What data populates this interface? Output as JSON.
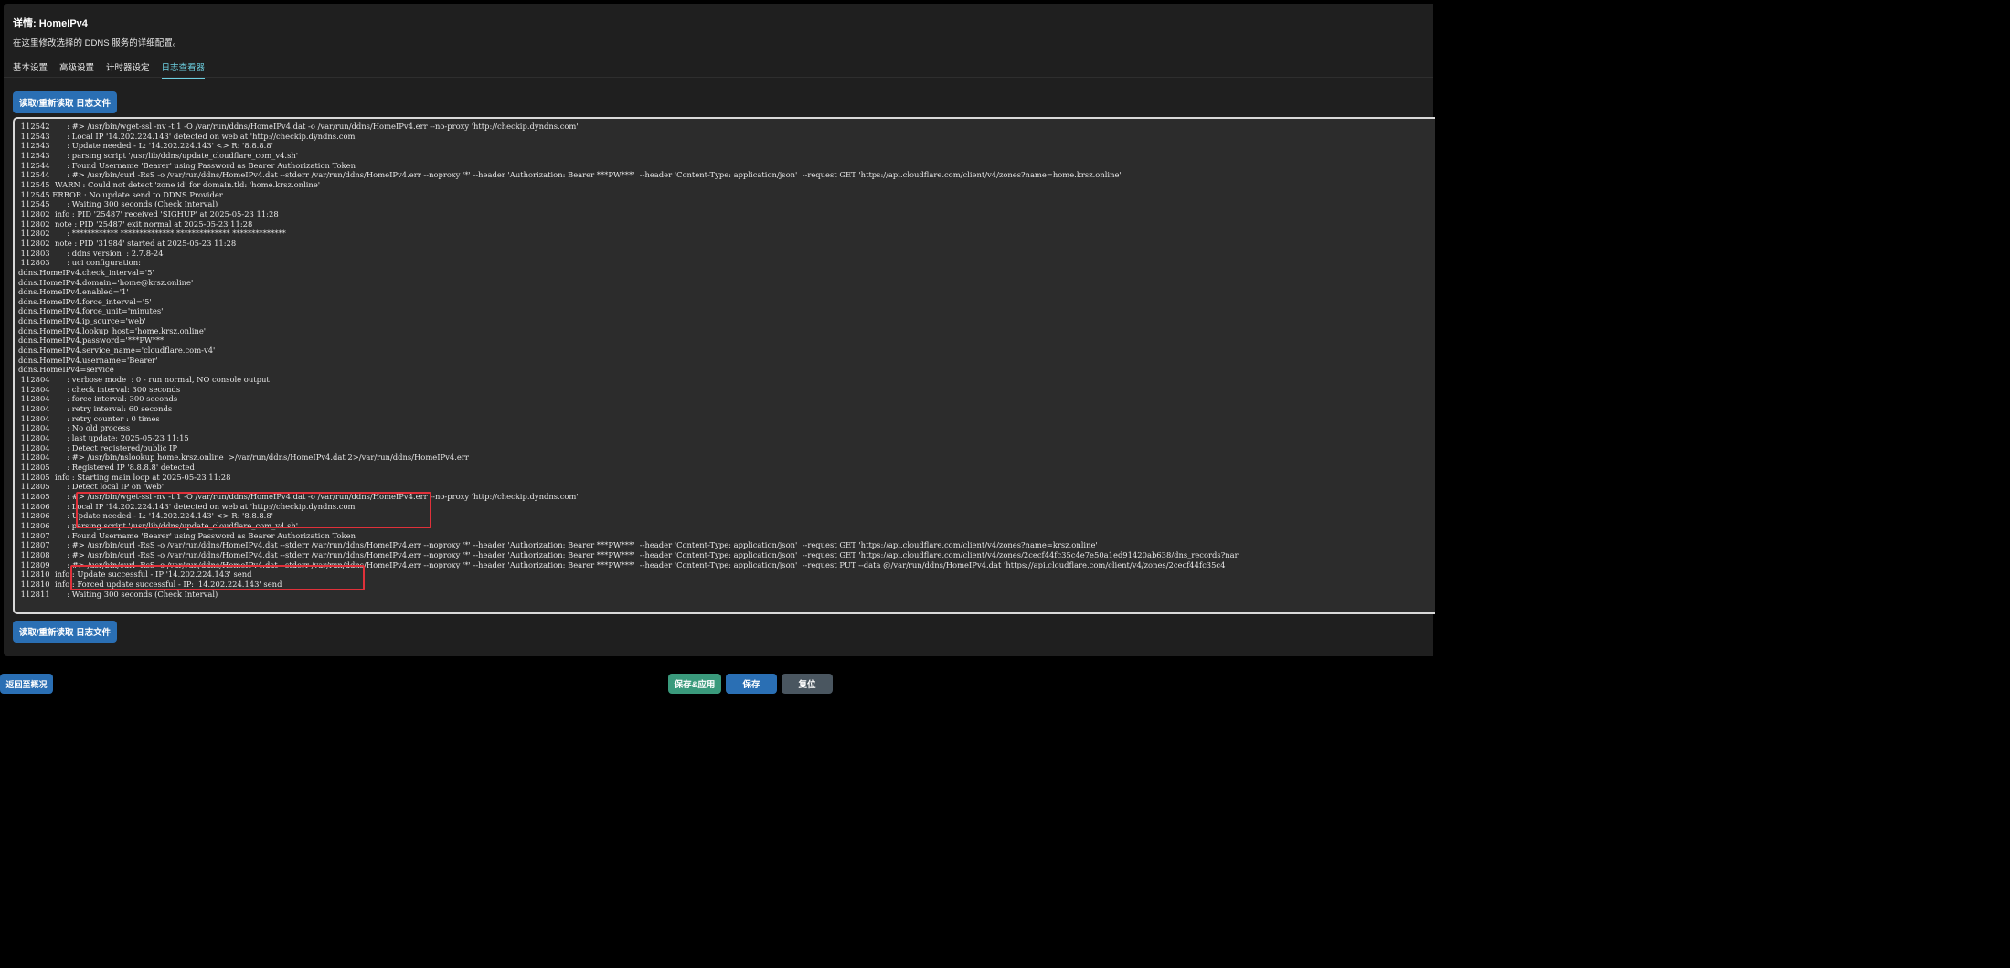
{
  "header": {
    "title": "详情: HomeIPv4",
    "description": "在这里修改选择的 DDNS 服务的详细配置。"
  },
  "tabs": [
    {
      "label": "基本设置",
      "active": false
    },
    {
      "label": "高级设置",
      "active": false
    },
    {
      "label": "计时器设定",
      "active": false
    },
    {
      "label": "日志查看器",
      "active": true
    }
  ],
  "read_button_label": "读取/重新读取 日志文件",
  "log_lines": [
    " 112542       : #> /usr/bin/wget-ssl -nv -t 1 -O /var/run/ddns/HomeIPv4.dat -o /var/run/ddns/HomeIPv4.err --no-proxy 'http://checkip.dyndns.com'",
    " 112543       : Local IP '14.202.224.143' detected on web at 'http://checkip.dyndns.com'",
    " 112543       : Update needed - L: '14.202.224.143' <> R: '8.8.8.8'",
    " 112543       : parsing script '/usr/lib/ddns/update_cloudflare_com_v4.sh'",
    " 112544       : Found Username 'Bearer' using Password as Bearer Authorization Token",
    " 112544       : #> /usr/bin/curl -RsS -o /var/run/ddns/HomeIPv4.dat --stderr /var/run/ddns/HomeIPv4.err --noproxy '*' --header 'Authorization: Bearer ***PW***'  --header 'Content-Type: application/json'  --request GET 'https://api.cloudflare.com/client/v4/zones?name=home.krsz.online'",
    " 112545  WARN : Could not detect 'zone id' for domain.tld: 'home.krsz.online'",
    " 112545 ERROR : No update send to DDNS Provider",
    " 112545       : Waiting 300 seconds (Check Interval)",
    " 112802  info : PID '25487' received 'SIGHUP' at 2025-05-23 11:28",
    " 112802  note : PID '25487' exit normal at 2025-05-23 11:28",
    " 112802       : ************ ************** ************** **************",
    " 112802  note : PID '31984' started at 2025-05-23 11:28",
    " 112803       : ddns version  : 2.7.8-24",
    " 112803       : uci configuration:",
    "ddns.HomeIPv4.check_interval='5'",
    "ddns.HomeIPv4.domain='home@krsz.online'",
    "ddns.HomeIPv4.enabled='1'",
    "ddns.HomeIPv4.force_interval='5'",
    "ddns.HomeIPv4.force_unit='minutes'",
    "ddns.HomeIPv4.ip_source='web'",
    "ddns.HomeIPv4.lookup_host='home.krsz.online'",
    "ddns.HomeIPv4.password='***PW***'",
    "ddns.HomeIPv4.service_name='cloudflare.com-v4'",
    "ddns.HomeIPv4.username='Bearer'",
    "ddns.HomeIPv4=service",
    " 112804       : verbose mode  : 0 - run normal, NO console output",
    " 112804       : check interval: 300 seconds",
    " 112804       : force interval: 300 seconds",
    " 112804       : retry interval: 60 seconds",
    " 112804       : retry counter : 0 times",
    " 112804       : No old process",
    " 112804       : last update: 2025-05-23 11:15",
    " 112804       : Detect registered/public IP",
    " 112804       : #> /usr/bin/nslookup home.krsz.online  >/var/run/ddns/HomeIPv4.dat 2>/var/run/ddns/HomeIPv4.err",
    " 112805       : Registered IP '8.8.8.8' detected",
    " 112805  info : Starting main loop at 2025-05-23 11:28",
    " 112805       : Detect local IP on 'web'",
    " 112805       : #> /usr/bin/wget-ssl -nv -t 1 -O /var/run/ddns/HomeIPv4.dat -o /var/run/ddns/HomeIPv4.err --no-proxy 'http://checkip.dyndns.com'",
    " 112806       : Local IP '14.202.224.143' detected on web at 'http://checkip.dyndns.com'",
    " 112806       : Update needed - L: '14.202.224.143' <> R: '8.8.8.8'",
    " 112806       : parsing script '/usr/lib/ddns/update_cloudflare_com_v4.sh'",
    " 112807       : Found Username 'Bearer' using Password as Bearer Authorization Token",
    " 112807       : #> /usr/bin/curl -RsS -o /var/run/ddns/HomeIPv4.dat --stderr /var/run/ddns/HomeIPv4.err --noproxy '*' --header 'Authorization: Bearer ***PW***'  --header 'Content-Type: application/json'  --request GET 'https://api.cloudflare.com/client/v4/zones?name=krsz.online'",
    " 112808       : #> /usr/bin/curl -RsS -o /var/run/ddns/HomeIPv4.dat --stderr /var/run/ddns/HomeIPv4.err --noproxy '*' --header 'Authorization: Bearer ***PW***'  --header 'Content-Type: application/json'  --request GET 'https://api.cloudflare.com/client/v4/zones/2cecf44fc35c4e7e50a1ed91420ab638/dns_records?nar",
    " 112809       : #> /usr/bin/curl -RsS -o /var/run/ddns/HomeIPv4.dat --stderr /var/run/ddns/HomeIPv4.err --noproxy '*' --header 'Authorization: Bearer ***PW***'  --header 'Content-Type: application/json'  --request PUT --data @/var/run/ddns/HomeIPv4.dat 'https://api.cloudflare.com/client/v4/zones/2cecf44fc35c4",
    " 112810  info : Update successful - IP '14.202.224.143' send",
    " 112810  info : Forced update successful - IP: '14.202.224.143' send",
    " 112811       : Waiting 300 seconds (Check Interval)"
  ],
  "footer": {
    "back_label": "返回至概况",
    "save_apply_label": "保存&应用",
    "save_label": "保存",
    "reset_label": "复位"
  },
  "colors": {
    "primary_button": "#2a6fb4",
    "active_tab": "#6ccfe0",
    "highlight_box": "#e0313a",
    "save_apply_button": "#3a9a7c",
    "reset_button": "#4a5660"
  }
}
